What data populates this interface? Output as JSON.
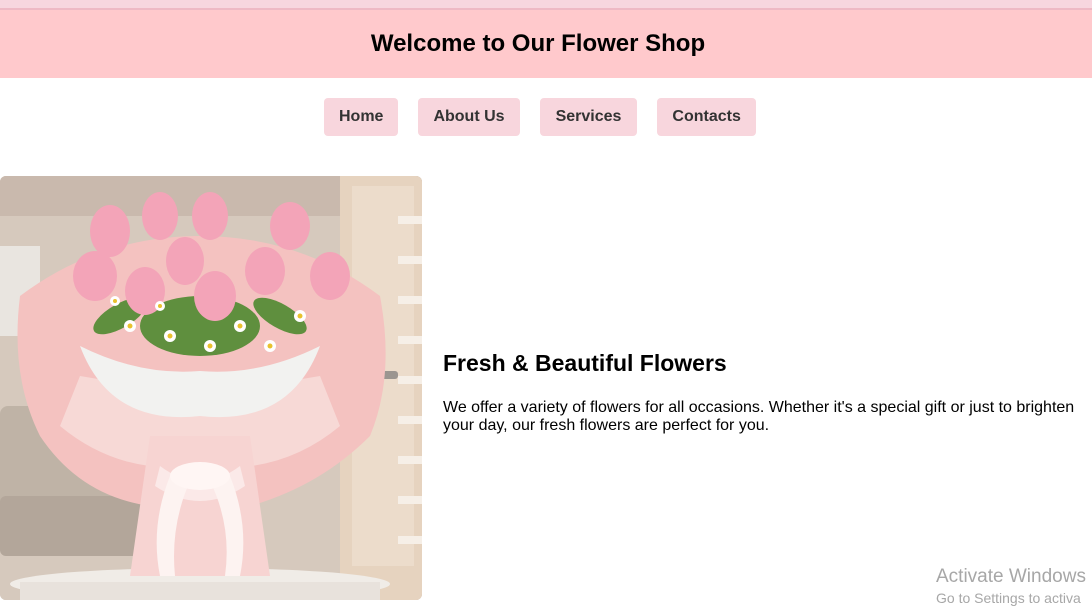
{
  "header": {
    "title": "Welcome to Our Flower Shop"
  },
  "nav": {
    "items": [
      {
        "label": "Home"
      },
      {
        "label": "About Us"
      },
      {
        "label": "Services"
      },
      {
        "label": "Contacts"
      }
    ]
  },
  "hero": {
    "image_icon": "flower-bouquet-image"
  },
  "content": {
    "heading": "Fresh & Beautiful Flowers",
    "text": "We offer a variety of flowers for all occasions. Whether it's a special gift or just to brighten your day, our fresh flowers are perfect for you."
  },
  "watermark": {
    "line1": "Activate Windows",
    "line2": "Go to Settings to activa"
  },
  "colors": {
    "header_bg": "#ffc9cc",
    "nav_button_bg": "#f8d6dd"
  }
}
